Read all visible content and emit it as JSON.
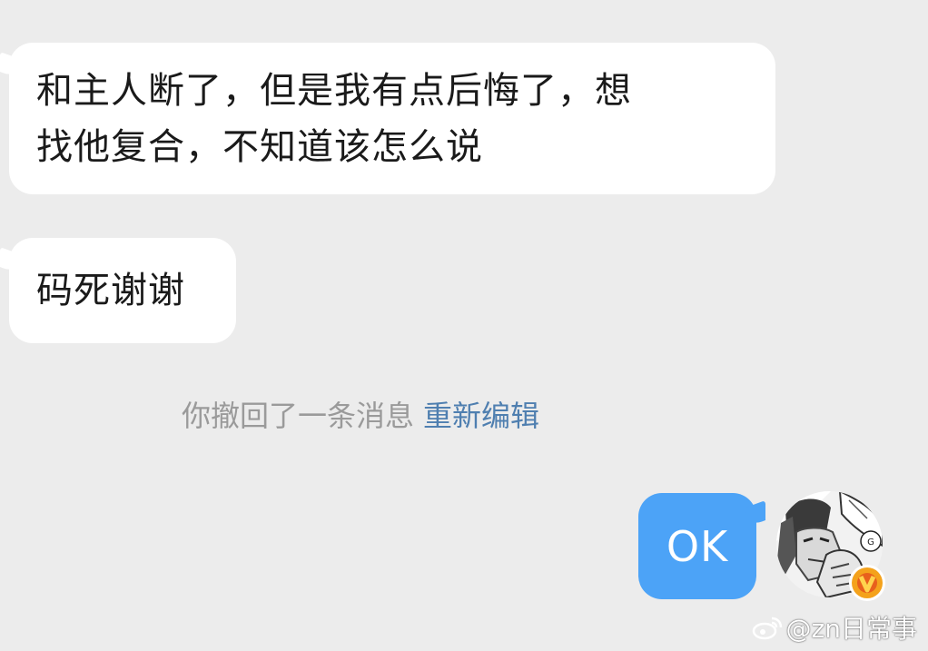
{
  "messages": [
    {
      "from": "other",
      "lines": [
        "和主人断了，但是我有点后悔了，想",
        "找他复合，不知道该怎么说"
      ]
    },
    {
      "from": "other",
      "text": "码死谢谢"
    }
  ],
  "recall_notice": {
    "text": "你撤回了一条消息",
    "action": "重新编辑"
  },
  "my_message": {
    "text": "OK"
  },
  "avatar_icon": "manga-portrait-avatar",
  "verified_icon": "verified-v-badge",
  "watermark": {
    "text": "@zn日常事"
  },
  "colors": {
    "background": "#ececec",
    "incoming_bubble": "#ffffff",
    "outgoing_bubble": "#4ca3f7",
    "reedit_link": "#4f7fb0",
    "verified_badge": "#f4a21c"
  }
}
